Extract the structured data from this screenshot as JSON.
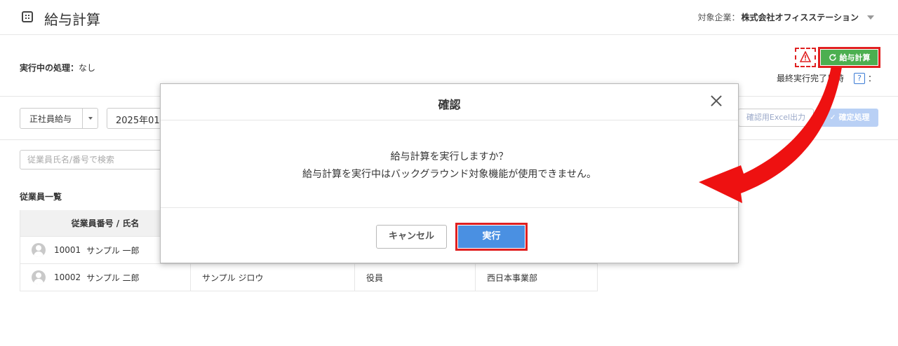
{
  "header": {
    "title": "給与計算",
    "company_label": "対象企業：",
    "company_name": "株式会社オフィスステーション"
  },
  "status": {
    "label": "実行中の処理：",
    "value": "なし",
    "calc_button": "給与計算",
    "last_run_label": "最終実行完了日時",
    "help": "?",
    "colon": "："
  },
  "filters": {
    "employment_type": "正社員給与",
    "period": "2025年01",
    "excel_button": "確認用Excel出力",
    "confirm_button": "確定処理",
    "search_placeholder": "従業員氏名/番号で検索"
  },
  "list": {
    "title": "従業員一覧",
    "header": "従業員番号 / 氏名",
    "rows": [
      {
        "no": "10001",
        "name": "サンプル 一郎",
        "kana": "",
        "position": "",
        "dept": ""
      },
      {
        "no": "10002",
        "name": "サンプル 二郎",
        "kana": "サンプル ジロウ",
        "position": "役員",
        "dept": "西日本事業部"
      }
    ]
  },
  "modal": {
    "title": "確認",
    "message_line1": "給与計算を実行しますか？",
    "message_line2": "給与計算を実行中はバックグラウンド対象機能が使用できません。",
    "cancel": "キャンセル",
    "execute": "実行"
  },
  "colors": {
    "highlight": "#e02020",
    "calc_green": "#4caf50",
    "primary_blue": "#4a90e2"
  }
}
